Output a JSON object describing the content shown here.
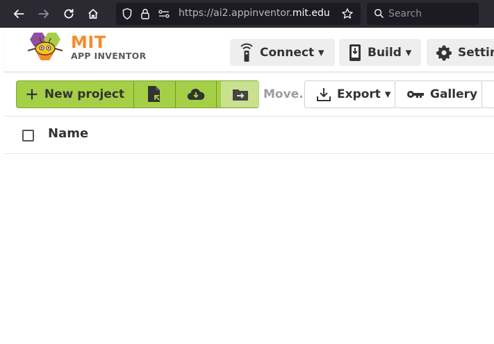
{
  "browser": {
    "url_prefix": "https://ai2.appinventor.",
    "url_domain": "mit.edu",
    "search_placeholder": "Search",
    "icons": [
      "back-arrow-icon",
      "forward-arrow-icon",
      "reload-icon",
      "home-icon",
      "shield-icon",
      "lock-icon",
      "permissions-icon",
      "bookmark-star-icon",
      "search-icon"
    ]
  },
  "header": {
    "logo_mit": "MIT",
    "logo_app_inventor": "APP INVENTOR",
    "connect_label": "Connect ▾",
    "build_label": "Build ▾",
    "settings_label": "Settin"
  },
  "toolbar": {
    "new_project_label": "New project",
    "move_label": "Move...",
    "export_label": "Export ▾",
    "gallery_label": "Gallery"
  },
  "project_list": {
    "column_name": "Name",
    "rows": []
  },
  "colors": {
    "accent_green": "#a5cf47",
    "logo_orange": "#f28c28",
    "browser_chrome": "#2b2a33"
  }
}
